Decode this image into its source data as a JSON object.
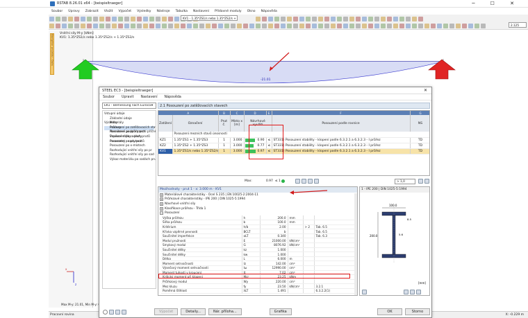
{
  "app": {
    "title": "RSTAB 8.26.01 x64 - [beispieltraeger]",
    "menu": [
      "Soubor",
      "Úpravy",
      "Zobrazit",
      "Vložit",
      "Výpočet",
      "Výsledky",
      "Nástroje",
      "Tabulka",
      "Nastavení",
      "Přídavné moduly",
      "Okno",
      "Nápověda"
    ],
    "toolbar_case": "KV1 - 1.35*ZS1/s nebo 1.35*ZS2/s + 1.35*ZS3/s",
    "toolbar_zoom": "2.125"
  },
  "canvas": {
    "title": "Vnitřní síly M-y [kNm]",
    "subtitle": "KV1: 1.35*ZS1/s nebo 1.35*ZS2/s + 1.35*ZS3/s",
    "value": "-21.01",
    "side_tab": "Navigátor projektu - Data",
    "bottom_label": "Max M-y: 21.01, Min M-y: 0.0",
    "status": "Pracovní rovina",
    "status_right": "X: -0.229 m"
  },
  "dialog": {
    "title": "STEEL EC3 - [beispieltraeger]",
    "menu": [
      "Soubor",
      "Upravit",
      "Nastavení",
      "Nápověda"
    ],
    "selector": "EK1 - Bemessung nach Eurocod",
    "section_title": "2.1 Posouzení po zatěžovacích stavech",
    "nav": {
      "input_title": "Vstupní údaje",
      "input_items": [
        "Základní údaje",
        "Materiály",
        "Průřezy",
        "Nosníkové podpory proti příčně",
        "Vzpěrné délky - pruty",
        "Parametry - sady prutů"
      ],
      "results_title": "Výsledky",
      "results_items": [
        "Posouzení po zatěžovacích stav",
        "Posouzení po průřezech",
        "Posouzení po sadách prutů",
        "Posouzení po prutech",
        "Posouzení po x-místech",
        "Rozhodující vnitřní síly po pr",
        "Rozhodující vnitřní síly po sad",
        "Výkaz materiálu po sadách prut"
      ]
    },
    "table": {
      "col_letters": [
        "A",
        "B",
        "C",
        "D",
        "E",
        "F",
        "G"
      ],
      "headers": {
        "zat": "Zatížení",
        "ozn": "Označení",
        "prut": "Prut č.",
        "misto": "Místo x [m]",
        "navrh": "Návrhové využití",
        "pos": "Posouzení podle rovnice",
        "ns": "NS"
      },
      "group_label": "Posouzení mezních stavů únosnosti",
      "rows": [
        {
          "load": "KZ1",
          "desc": "1.35*ZS1 + 1.35*ZS3",
          "member": "1",
          "x": "3.000",
          "ratio": "0.90",
          "fill": 0.9,
          "le": "≤ 1",
          "eq": "ST331) Posouzení stability - klopení podle 6.3.2.1 a 6.3.2.3 - I průřez",
          "ns": "TD"
        },
        {
          "load": "KZ2",
          "desc": "1.35*ZS2 + 1.35*ZS3",
          "member": "1",
          "x": "3.000",
          "ratio": "0.77",
          "fill": 0.77,
          "le": "≤ 1",
          "eq": "ST331) Posouzení stability - klopení podle 6.3.2.1 a 6.3.2.3 - I průřez",
          "ns": "TD"
        },
        {
          "load": "KV1",
          "desc": "1.35*ZS1/s nebo 1.35*ZS2/s",
          "member": "1",
          "x": "3.000",
          "ratio": "0.97",
          "fill": 0.97,
          "le": "≤ 1",
          "eq": "ST331) Posouzení stability - klopení podle 6.3.2.1 a 6.3.2.3 - I průřez",
          "ns": "TD"
        }
      ],
      "max_label": "Max:",
      "max_value": "0.97",
      "max_le": "≤ 1",
      "ratio_select": "> 1,0"
    },
    "props_title": "Mezihodnoty - prut 1 - x: 3.000 m - KV1",
    "groups": [
      "Materiálové charakteristiky - Ocel S 235 | EN 10025-2:2004-11",
      "Průřezové charakteristiky - IPE 200 | DIN 1025-5:1994",
      "Návrhové vnitřní síly",
      "Klasifikace průřezu - Třída 1"
    ],
    "pos_group": "Posouzení",
    "props": [
      [
        "Výška průřezu",
        "h",
        "200.0",
        "mm",
        "",
        ""
      ],
      [
        "Šířka průřezu",
        "b",
        "100.0",
        "mm",
        "",
        ""
      ],
      [
        "Kritérium",
        "h/b",
        "2.00",
        "",
        "> 2",
        "Tab. 6.5"
      ],
      [
        "Křivka vzpěrné pevnosti",
        "BCLT",
        "b",
        "",
        "",
        "Tab. 6.5"
      ],
      [
        "Součinitel imperfekce",
        "αLT",
        "0.340",
        "",
        "",
        "Tab. 6.3"
      ],
      [
        "Modul pružnosti",
        "E",
        "21000.00",
        "kN/cm²",
        "",
        ""
      ],
      [
        "Smykový modul",
        "G",
        "8076.92",
        "kN/cm²",
        "",
        ""
      ],
      [
        "Součinitel délky",
        "kz",
        "1.000",
        "",
        "",
        ""
      ],
      [
        "Součinitel délky",
        "kw",
        "1.000",
        "",
        "",
        ""
      ],
      [
        "Délka",
        "L",
        "6.000",
        "m",
        "",
        ""
      ],
      [
        "Moment setrvačnosti",
        "Iz",
        "142.00",
        "cm⁴",
        "",
        ""
      ],
      [
        "Výsečový moment setrvačnosti",
        "Iω",
        "12990.00",
        "cm⁶",
        "",
        ""
      ],
      [
        "Moment tuhosti v kroucení",
        "It",
        "7.02",
        "cm⁴",
        "",
        ""
      ],
      [
        "Kritický moment při klopení",
        "Mcr",
        "23.25",
        "kNm",
        "",
        ""
      ],
      [
        "Průřezový modul",
        "Wy",
        "220.00",
        "cm³",
        "",
        ""
      ],
      [
        "Mez kluzu",
        "fy",
        "23.50",
        "kN/cm²",
        "",
        "3.2.1"
      ],
      [
        "Poměrná štíhlost",
        "λLT",
        "1.491",
        "",
        "",
        "6.3.2.2(1)"
      ]
    ],
    "section_panel_title": "1 - IPE 200 | DIN 1025-5:1994",
    "dims": {
      "width": "100.0",
      "height": "200.0",
      "web": "5.6",
      "flange": "8.5",
      "unit": "[mm]"
    },
    "buttons": {
      "calc": "Výpočet",
      "details": "Detaily...",
      "nat": "Nár. příloha...",
      "graph": "Grafika",
      "ok": "OK",
      "cancel": "Storno"
    }
  }
}
